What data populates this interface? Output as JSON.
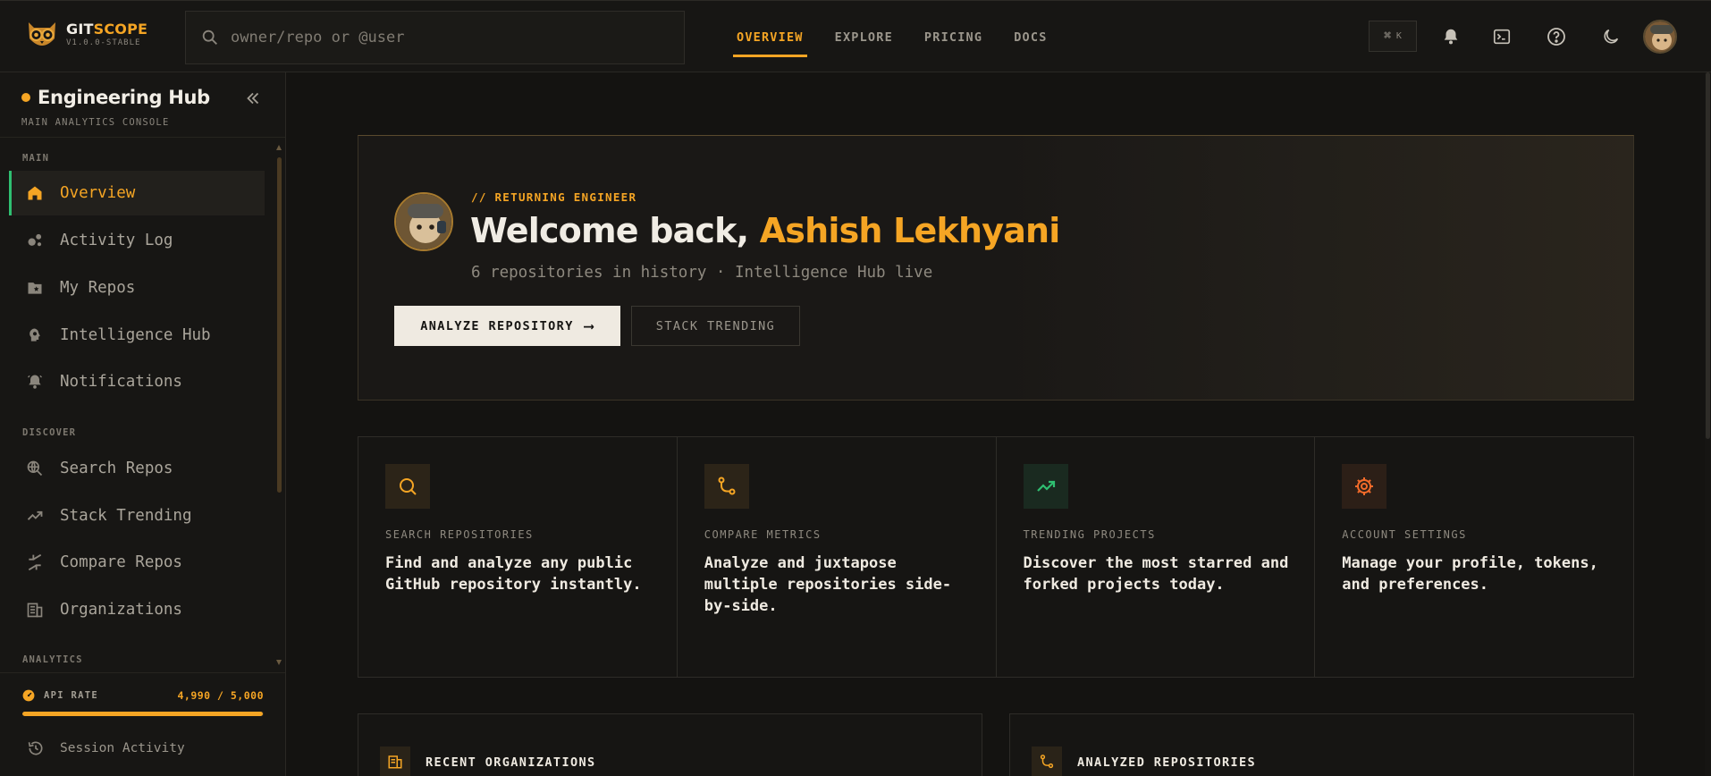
{
  "app": {
    "name_part1": "GIT",
    "name_part2": "SCOPE",
    "version": "V1.0.0-STABLE"
  },
  "search": {
    "placeholder": "owner/repo or @user"
  },
  "nav": {
    "items": [
      {
        "label": "OVERVIEW",
        "active": true
      },
      {
        "label": "EXPLORE",
        "active": false
      },
      {
        "label": "PRICING",
        "active": false
      },
      {
        "label": "DOCS",
        "active": false
      }
    ]
  },
  "toolbar": {
    "shortcut_symbol": "⌘",
    "shortcut_key": "K",
    "icons": [
      "bell-icon",
      "terminal-icon",
      "help-icon",
      "moon-icon"
    ]
  },
  "sidebar": {
    "title": "Engineering Hub",
    "subtitle": "MAIN ANALYTICS CONSOLE",
    "sections": [
      {
        "label": "MAIN"
      },
      {
        "label": "DISCOVER"
      },
      {
        "label": "ANALYTICS"
      }
    ],
    "main_items": [
      {
        "label": "Overview",
        "icon": "home-icon",
        "active": true
      },
      {
        "label": "Activity Log",
        "icon": "activity-icon"
      },
      {
        "label": "My Repos",
        "icon": "folder-star-icon"
      },
      {
        "label": "Intelligence Hub",
        "icon": "brain-icon"
      },
      {
        "label": "Notifications",
        "icon": "bell-icon"
      }
    ],
    "discover_items": [
      {
        "label": "Search Repos",
        "icon": "search-globe-icon"
      },
      {
        "label": "Stack Trending",
        "icon": "trending-icon"
      },
      {
        "label": "Compare Repos",
        "icon": "compare-icon"
      },
      {
        "label": "Organizations",
        "icon": "building-icon"
      }
    ],
    "footer": {
      "api_label": "API RATE",
      "api_value": "4,990 / 5,000",
      "api_fraction": 0.998,
      "session_label": "Session Activity"
    }
  },
  "hero": {
    "kicker": "// RETURNING ENGINEER",
    "greeting": "Welcome back, ",
    "user_name": "Ashish Lekhyani",
    "subtitle": "6 repositories in history · Intelligence Hub live",
    "primary_button": "ANALYZE REPOSITORY",
    "primary_arrow": "⟶",
    "secondary_button": "STACK TRENDING"
  },
  "cards": [
    {
      "label": "SEARCH REPOSITORIES",
      "text": "Find and analyze any public GitHub repository instantly.",
      "icon": "search-icon",
      "color": "#f5a524"
    },
    {
      "label": "COMPARE METRICS",
      "text": "Analyze and juxtapose multiple repositories side-by-side.",
      "icon": "git-branch-icon",
      "color": "#f5a524"
    },
    {
      "label": "TRENDING PROJECTS",
      "text": "Discover the most starred and forked projects today.",
      "icon": "trending-up-icon",
      "color": "#2fbf71"
    },
    {
      "label": "ACCOUNT SETTINGS",
      "text": "Manage your profile, tokens, and preferences.",
      "icon": "gear-icon",
      "color": "#f26b2a"
    }
  ],
  "panels": [
    {
      "title": "RECENT ORGANIZATIONS",
      "icon": "building-icon"
    },
    {
      "title": "ANALYZED REPOSITORIES",
      "icon": "git-branch-icon"
    }
  ],
  "colors": {
    "accent": "#f5a524",
    "success": "#2fbf71",
    "danger": "#f26b2a",
    "background": "#141311"
  }
}
